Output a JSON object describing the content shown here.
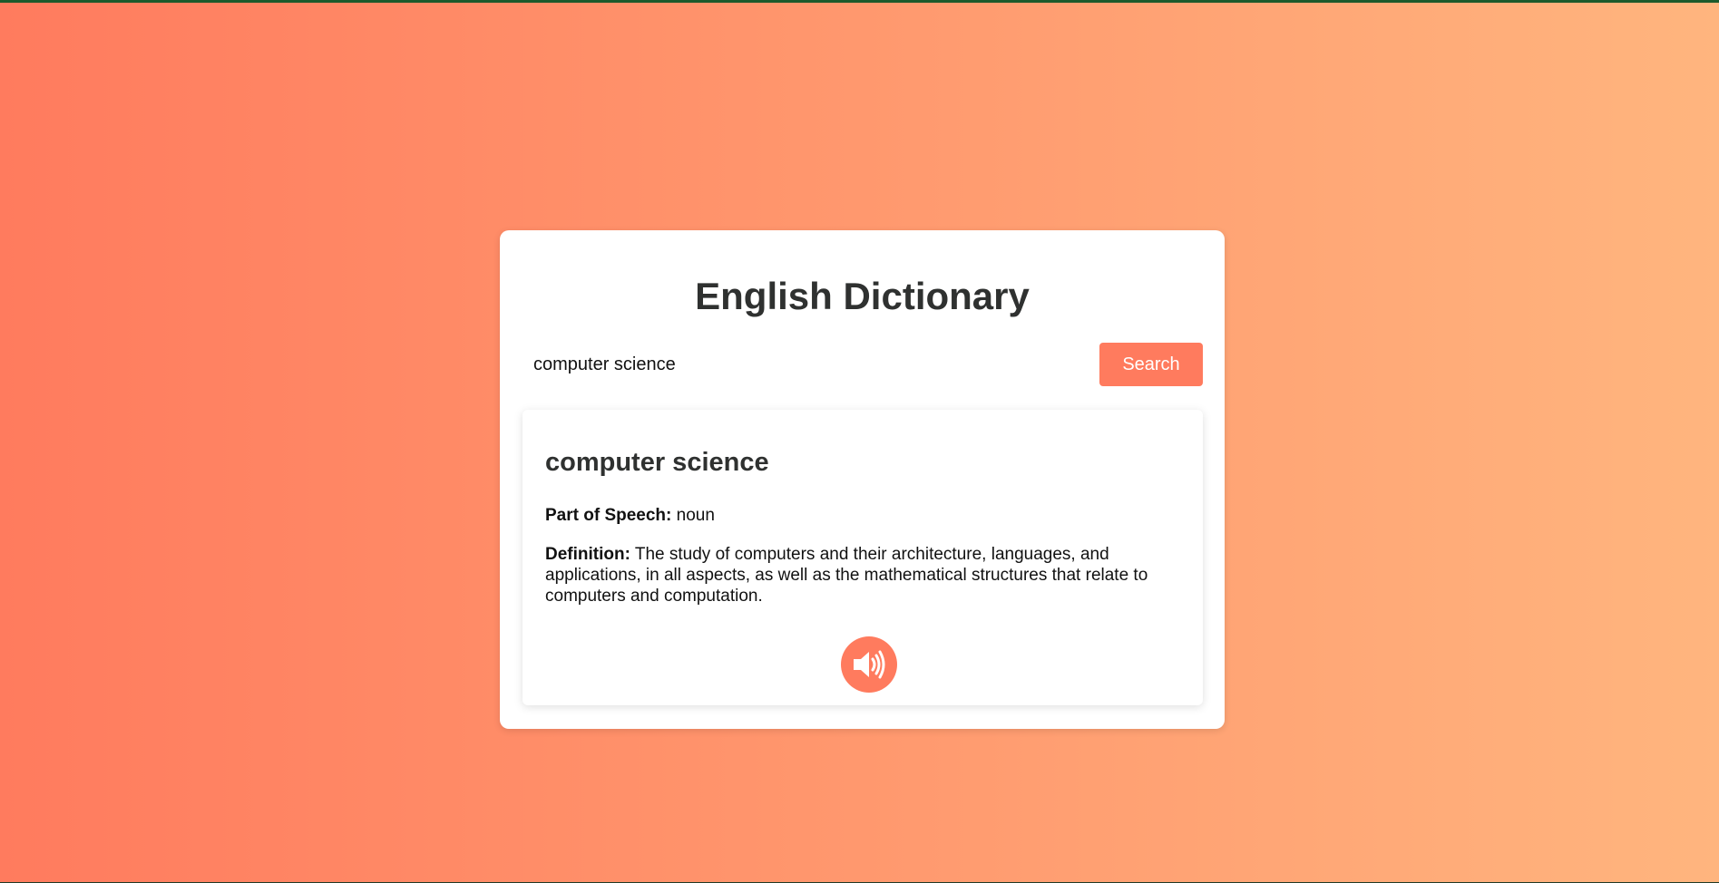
{
  "app": {
    "title": "English Dictionary"
  },
  "search": {
    "value": "computer science",
    "button_label": "Search"
  },
  "result": {
    "word": "computer science",
    "part_of_speech_label": "Part of Speech:",
    "part_of_speech": "noun",
    "definition_label": "Definition:",
    "definition": "The study of computers and their architecture, languages, and applications, in all aspects, as well as the mathematical structures that relate to computers and computation.",
    "audio_icon": "speaker-volume-icon"
  },
  "colors": {
    "accent": "#ff7b5e",
    "gradient_start": "#ff7b5e",
    "gradient_end": "#ffb57e",
    "text_dark": "#2f3130"
  }
}
